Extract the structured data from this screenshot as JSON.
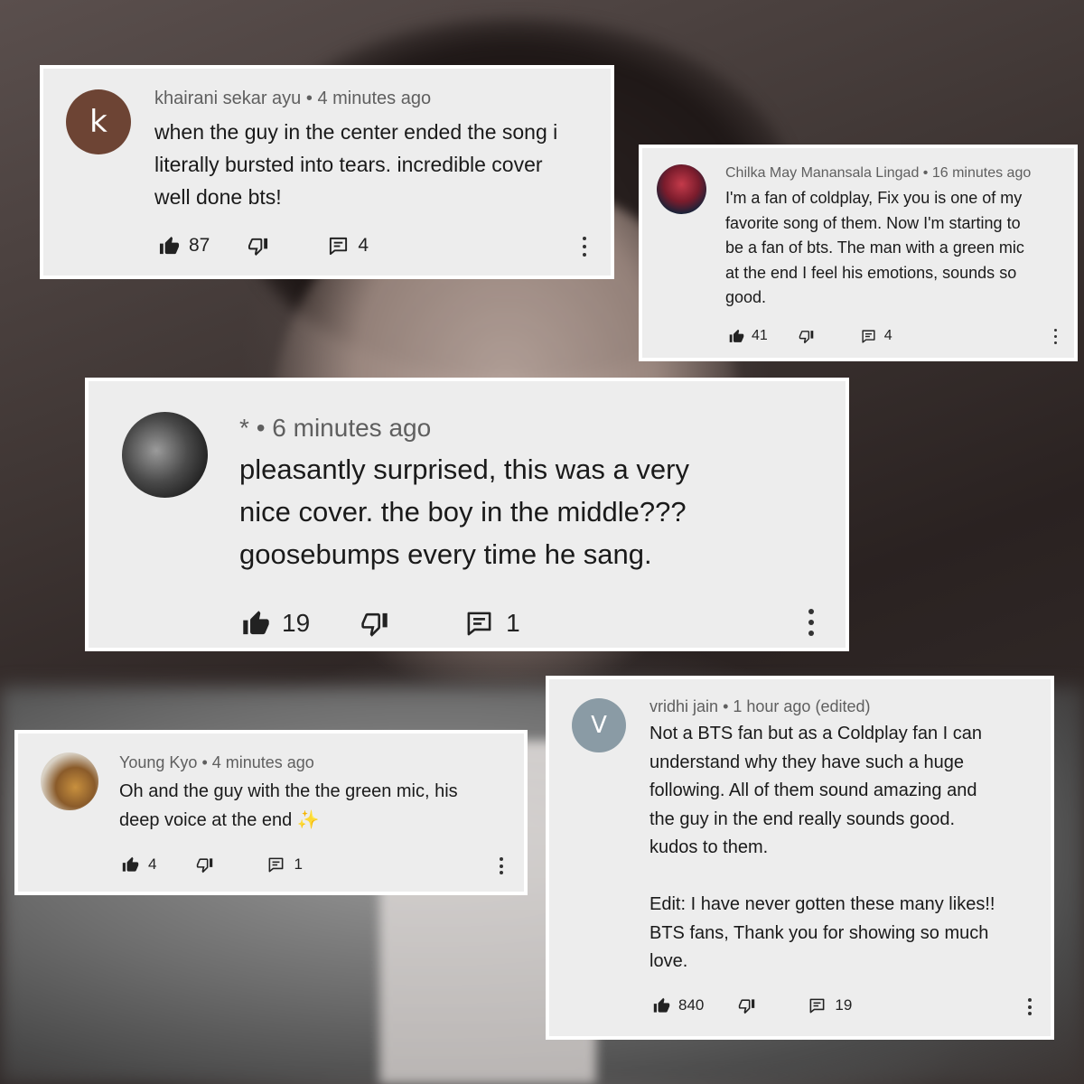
{
  "comments": [
    {
      "avatar_letter": "k",
      "author": "khairani sekar ayu",
      "time": "4 minutes ago",
      "text": "when the guy in the center ended the song i\nliterally bursted into tears. incredible cover\nwell done bts!",
      "likes": "87",
      "replies": "4"
    },
    {
      "avatar_letter": "",
      "author": "Chilka May Manansala Lingad",
      "time": "16 minutes ago",
      "text": "I'm a fan of coldplay, Fix you is one of my\nfavorite song of them. Now I'm starting to\nbe a fan of bts. The man with a green mic\nat the end I  feel his emotions, sounds so\ngood.",
      "likes": "41",
      "replies": "4"
    },
    {
      "avatar_letter": "",
      "author": "*",
      "time": "6 minutes ago",
      "text": "pleasantly surprised, this was a very\nnice cover. the boy in the middle???\ngoosebumps every time he sang.",
      "likes": "19",
      "replies": "1"
    },
    {
      "avatar_letter": "",
      "author": "Young Kyo",
      "time": "4 minutes ago",
      "text": "Oh and the guy with the the green mic, his\ndeep voice at the end",
      "emoji": "✨",
      "likes": "4",
      "replies": "1"
    },
    {
      "avatar_letter": "V",
      "author": "vridhi jain",
      "time": "1 hour ago (edited)",
      "text": "Not a BTS fan but as a Coldplay fan I can\nunderstand why they have such a huge\nfollowing. All of them sound amazing and\nthe guy in the end really sounds good.\nkudos to them.\n\nEdit: I have never gotten these many likes!!\nBTS fans, Thank you for showing so much\nlove.",
      "likes": "840",
      "replies": "19"
    }
  ],
  "separator": "•",
  "icons": {
    "like": "thumbs-up-icon",
    "dislike": "thumbs-down-icon",
    "reply": "reply-icon",
    "more": "more-options-icon"
  }
}
